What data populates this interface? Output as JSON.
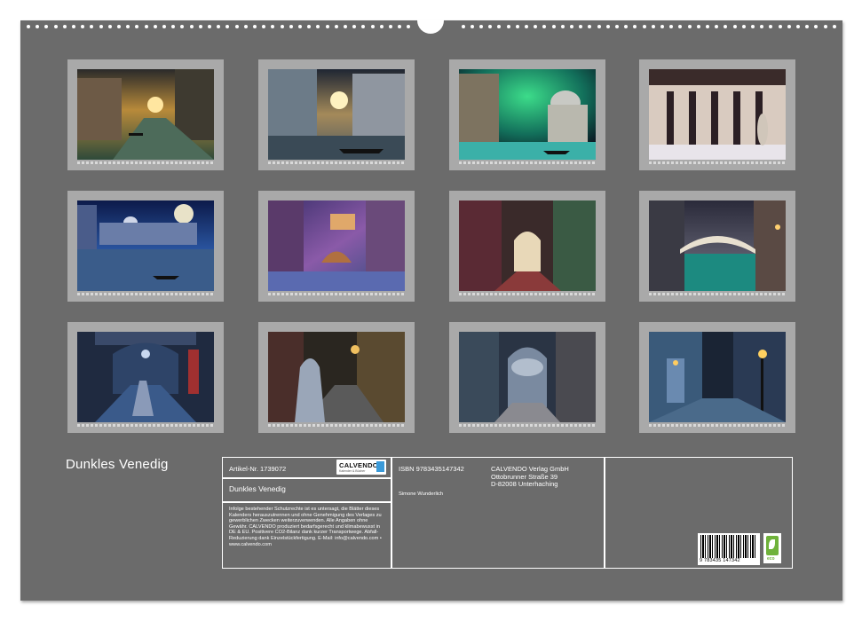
{
  "calendar": {
    "title": "Dunkles Venedig",
    "thumbnails": [
      {
        "scene": "canal-sunset"
      },
      {
        "scene": "gondola-palace"
      },
      {
        "scene": "green-nebula-basilica"
      },
      {
        "scene": "cloister-arcade"
      },
      {
        "scene": "moon-grand-canal"
      },
      {
        "scene": "purple-canal"
      },
      {
        "scene": "dark-alley-arch"
      },
      {
        "scene": "canal-bridge"
      },
      {
        "scene": "portico-lady"
      },
      {
        "scene": "hooded-figure"
      },
      {
        "scene": "foggy-arch"
      },
      {
        "scene": "blue-lantern"
      }
    ]
  },
  "info": {
    "article_no": "Artikel-Nr. 1739072",
    "product_title": "Dunkles Venedig",
    "legal_text": "Infolge bestehender Schutzrechte ist es untersagt, die Blätter dieses Kalenders herauszutrennen und ohne Genehmigung des Verlages zu gewerblichen Zwecken weiterzuverwenden. Alle Angaben ohne Gewähr. CALVENDO produziert bedarfsgerecht und klimabewusst in DE & EU. Positivere CO2-Bilanz dank kurzer Transportwege. Abfall-Reduzierung dank Einzelstückfertigung. E-Mail: info@calvendo.com • www.calvendo.com",
    "isbn": "ISBN 9783435147342",
    "author": "Simone Wunderlich",
    "publisher_name": "CALVENDO Verlag GmbH",
    "publisher_street": "Ottobrunner Straße 39",
    "publisher_city": "D-82008 Unterhaching",
    "logo_text": "CALVENDO",
    "logo_sub": "Kalender & Bücher",
    "barcode_number": "9 783435 147342",
    "eco_label": "eco"
  }
}
